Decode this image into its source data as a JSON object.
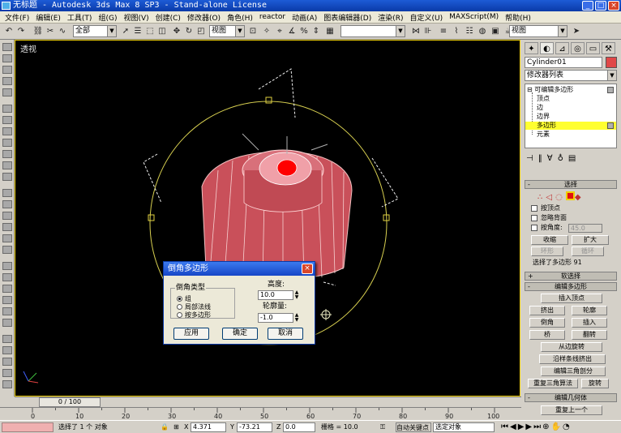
{
  "window": {
    "title": "无标题  - Autodesk 3ds Max 8 SP3  - Stand-alone License",
    "minimize": "_",
    "maximize": "□",
    "close": "×"
  },
  "menu": [
    "文件(F)",
    "编辑(E)",
    "工具(T)",
    "组(G)",
    "视图(V)",
    "创建(C)",
    "修改器(O)",
    "角色(H)",
    "reactor",
    "动画(A)",
    "图表编辑器(D)",
    "渲染(R)",
    "自定义(U)",
    "MAXScript(M)",
    "帮助(H)"
  ],
  "toolbar": {
    "selection_filter": "全部",
    "coord_system": "视图",
    "named_selection": "",
    "viewport_combo": "视图"
  },
  "viewport": {
    "label": "透视",
    "border_color": "#f0d000",
    "background": "#000000",
    "object_color": "#c9505a",
    "selected_face_color": "#ff0000"
  },
  "command_panel": {
    "object_name": "Cylinder01",
    "object_color": "#e04848",
    "modifier_list": "修改器列表",
    "stack": [
      {
        "label": "可编辑多边形",
        "level": 0,
        "selected": false
      },
      {
        "label": "顶点",
        "level": 1,
        "selected": false
      },
      {
        "label": "边",
        "level": 1,
        "selected": false
      },
      {
        "label": "边界",
        "level": 1,
        "selected": false
      },
      {
        "label": "多边形",
        "level": 1,
        "selected": true
      },
      {
        "label": "元素",
        "level": 1,
        "selected": false
      }
    ],
    "stack_expand_sign": "⊟",
    "selection_rollout": {
      "title": "选择",
      "by_vertex": "按顶点",
      "ignore_backfacing": "忽略背面",
      "by_angle": "按角度:",
      "angle_value": "45.0",
      "shrink": "收缩",
      "grow": "扩大",
      "ring": "环形",
      "loop": "循环",
      "status": "选择了多边形 91"
    },
    "soft_selection_title": "软选择",
    "edit_polygons": {
      "title": "编辑多边形",
      "insert_vertex": "插入顶点",
      "extrude": "挤出",
      "outline": "轮廓",
      "bevel": "倒角",
      "inset": "插入",
      "bridge": "桥",
      "flip": "翻转",
      "hinge_from_edge": "从边旋转",
      "extrude_along_spline": "沿样条线挤出",
      "edit_triangulation": "编辑三角剖分",
      "retriangulate": "重复三角算法",
      "turn": "旋转"
    },
    "edit_geometry": {
      "title": "编辑几何体",
      "repeat_last": "重复上一个"
    },
    "rollout_plus": "+",
    "rollout_minus": "-"
  },
  "timeline": {
    "slider_label": "0 / 100",
    "ticks": [
      "0",
      "10",
      "20",
      "30",
      "40",
      "50",
      "60",
      "70",
      "80",
      "90",
      "100"
    ]
  },
  "status": {
    "selection": "选择了 1 个 对象",
    "x_label": "X",
    "x_value": "4.371",
    "y_label": "Y",
    "y_value": "-73.21",
    "z_label": "Z",
    "z_value": "0.0",
    "grid": "栅格 = 10.0",
    "auto_key": "自动关键点",
    "key_filter": "选定对象"
  },
  "dialog": {
    "title": "倒角多边形",
    "group_label": "倒角类型",
    "options": [
      {
        "label": "组",
        "checked": true
      },
      {
        "label": "局部法线",
        "checked": false
      },
      {
        "label": "按多边形",
        "checked": false
      }
    ],
    "height_label": "高度:",
    "height_value": "10.0",
    "outline_label": "轮廓量:",
    "outline_value": "-1.0",
    "apply": "应用",
    "ok": "确定",
    "cancel": "取消"
  }
}
